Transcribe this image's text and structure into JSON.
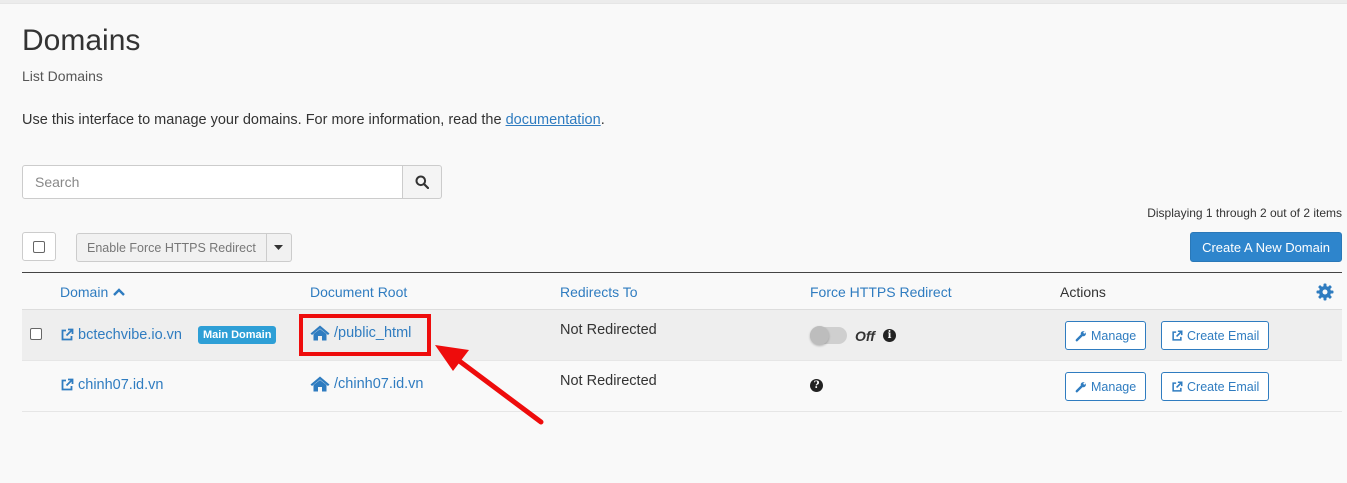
{
  "page": {
    "title": "Domains",
    "subtitle": "List Domains",
    "intro_text": "Use this interface to manage your domains. For more information, read the ",
    "intro_link": "documentation",
    "intro_end": "."
  },
  "search": {
    "placeholder": "Search"
  },
  "toolbar": {
    "display_count": "Displaying 1 through 2 out of 2 items",
    "bulk_action_label": "Enable Force HTTPS Redirect",
    "create_button": "Create A New Domain"
  },
  "table": {
    "columns": {
      "domain": "Domain",
      "document_root": "Document Root",
      "redirects_to": "Redirects To",
      "force_https": "Force HTTPS Redirect",
      "actions": "Actions"
    },
    "rows": [
      {
        "domain": "bctechvibe.io.vn",
        "badge": "Main Domain",
        "document_root": "/public_html",
        "redirects_to": "Not Redirected",
        "force_https_state": "Off",
        "manage_label": "Manage",
        "email_label": "Create Email"
      },
      {
        "domain": "chinh07.id.vn",
        "document_root": "/chinh07.id.vn",
        "redirects_to": "Not Redirected",
        "manage_label": "Manage",
        "email_label": "Create Email"
      }
    ]
  },
  "colors": {
    "link": "#2f7cc0",
    "primary_button": "#2e85cc",
    "badge": "#2e9fd6",
    "annotation": "#ee0c0c"
  },
  "icons": [
    "search-icon",
    "sort-up-icon",
    "external-link-icon",
    "home-icon",
    "info-icon",
    "question-icon",
    "wrench-icon",
    "gear-icon",
    "caret-down-icon"
  ]
}
